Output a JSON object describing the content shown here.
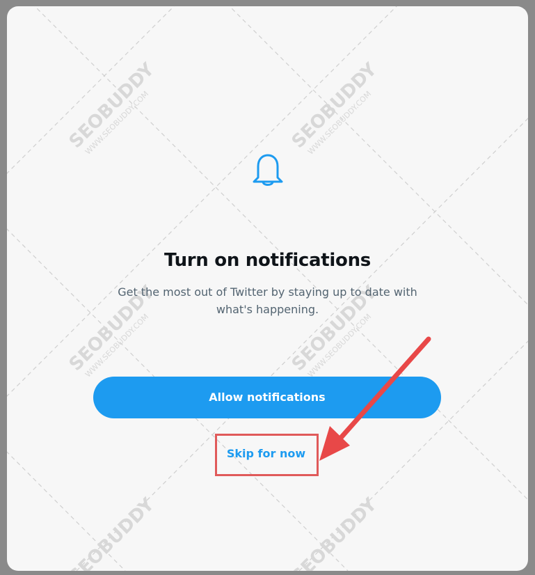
{
  "dialog": {
    "title": "Turn on notifications",
    "subtitle": "Get the most out of Twitter by staying up to date with what's happening.",
    "allow_label": "Allow notifications",
    "skip_label": "Skip for now"
  },
  "icons": {
    "bell": "bell-icon",
    "annotation_arrow": "arrow-icon"
  },
  "watermark": {
    "brand": "SEOBUDDY",
    "url": "WWW.SEOBUDDY.COM"
  },
  "colors": {
    "accent": "#1d9bf0",
    "annotation": "#e05a5a",
    "title": "#0f1419",
    "subtitle": "#536471"
  }
}
